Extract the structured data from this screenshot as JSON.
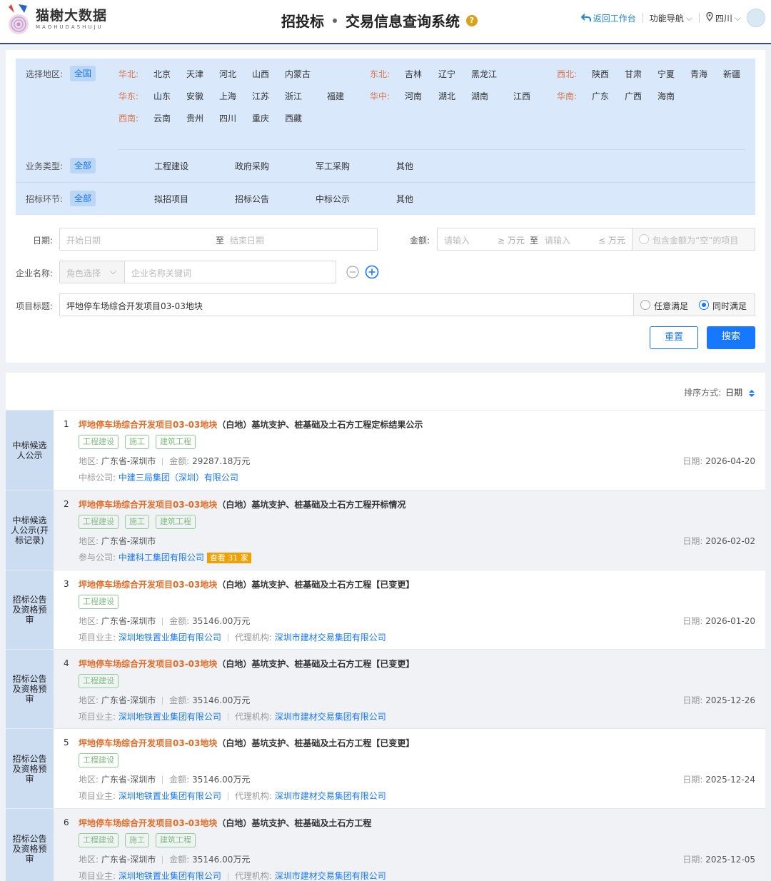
{
  "header": {
    "logo_cn": "猫榭大数据",
    "logo_en": "MAOHUDASHUJU",
    "title_a": "招投标",
    "title_b": "交易信息查询系统",
    "help": "?",
    "back": "返回工作台",
    "nav": "功能导航",
    "location": "四川"
  },
  "filters": {
    "region_label": "选择地区:",
    "region_all": "全国",
    "regions": {
      "huabei": {
        "name": "华北:",
        "items": [
          "北京",
          "天津",
          "河北",
          "山西",
          "内蒙古"
        ]
      },
      "dongbei": {
        "name": "东北:",
        "items": [
          "吉林",
          "辽宁",
          "黑龙江"
        ]
      },
      "xibei": {
        "name": "西北:",
        "items": [
          "陕西",
          "甘肃",
          "宁夏",
          "青海",
          "新疆"
        ]
      },
      "huadong": {
        "name": "华东:",
        "items": [
          "山东",
          "安徽",
          "上海",
          "江苏",
          "浙江",
          "福建"
        ]
      },
      "huazhong": {
        "name": "华中:",
        "items": [
          "河南",
          "湖北",
          "湖南",
          "江西"
        ]
      },
      "huanan": {
        "name": "华南:",
        "items": [
          "广东",
          "广西",
          "海南"
        ]
      },
      "xinan": {
        "name": "西南:",
        "items": [
          "云南",
          "贵州",
          "四川",
          "重庆",
          "西藏"
        ]
      }
    },
    "biz_label": "业务类型:",
    "biz_all": "全部",
    "biz_items": [
      "工程建设",
      "政府采购",
      "军工采购",
      "其他"
    ],
    "stage_label": "招标环节:",
    "stage_all": "全部",
    "stage_items": [
      "拟招项目",
      "招标公告",
      "中标公示",
      "其他"
    ],
    "date_label": "日期:",
    "date_start_ph": "开始日期",
    "date_to": "至",
    "date_end_ph": "结束日期",
    "amount_label": "金额:",
    "amount_min_ph": "请输入",
    "amount_min_unit": "≥ 万元",
    "amount_to": "至",
    "amount_max_ph": "请输入",
    "amount_max_unit": "≤ 万元",
    "amount_empty": "包含金额为“空”的项目",
    "company_label": "企业名称:",
    "role_ph": "角色选择",
    "company_ph": "企业名称关键词",
    "title_label": "项目标题:",
    "title_value": "坪地停车场综合开发项目03-03地块",
    "match_any": "任意满足",
    "match_all": "同时满足",
    "reset": "重置",
    "search": "搜索"
  },
  "results": {
    "sort_label": "排序方式:",
    "sort_value": "日期",
    "items": [
      {
        "num": "1",
        "stage": "中标候选人公示",
        "hl": "坪地停车场综合开发项目03-03地块",
        "rest": "（白地）基坑支护、桩基础及土石方工程定标结果公示",
        "tags": [
          "工程建设",
          "施工",
          "建筑工程"
        ],
        "region_label": "地区:",
        "region": "广东省-深圳市",
        "amount_label": "金额:",
        "amount": "29287.18万元",
        "date_label": "日期:",
        "date": "2026-04-20",
        "c1_label": "中标公司:",
        "c1": "中建三局集团（深圳）有限公司"
      },
      {
        "num": "2",
        "stage": "中标候选人公示(开标记录)",
        "hl": "坪地停车场综合开发项目03-03地块",
        "rest": "（白地）基坑支护、桩基础及土石方工程开标情况",
        "tags": [
          "工程建设",
          "施工",
          "建筑工程"
        ],
        "region_label": "地区:",
        "region": "广东省-深圳市",
        "date_label": "日期:",
        "date": "2026-02-02",
        "c1_label": "参与公司:",
        "c1": "中建科工集团有限公司",
        "count": "查看 31 家"
      },
      {
        "num": "3",
        "stage": "招标公告及资格预审",
        "hl": "坪地停车场综合开发项目03-03地块",
        "rest": "（白地）基坑支护、桩基础及土石方工程【已变更】",
        "tags": [
          "工程建设"
        ],
        "region_label": "地区:",
        "region": "广东省-深圳市",
        "amount_label": "金额:",
        "amount": "35146.00万元",
        "date_label": "日期:",
        "date": "2026-01-20",
        "c1_label": "项目业主:",
        "c1": "深圳地铁置业集团有限公司",
        "c2_label": "代理机构:",
        "c2": "深圳市建材交易集团有限公司"
      },
      {
        "num": "4",
        "stage": "招标公告及资格预审",
        "hl": "坪地停车场综合开发项目03-03地块",
        "rest": "（白地）基坑支护、桩基础及土石方工程【已变更】",
        "tags": [
          "工程建设"
        ],
        "region_label": "地区:",
        "region": "广东省-深圳市",
        "amount_label": "金额:",
        "amount": "35146.00万元",
        "date_label": "日期:",
        "date": "2025-12-26",
        "c1_label": "项目业主:",
        "c1": "深圳地铁置业集团有限公司",
        "c2_label": "代理机构:",
        "c2": "深圳市建材交易集团有限公司"
      },
      {
        "num": "5",
        "stage": "招标公告及资格预审",
        "hl": "坪地停车场综合开发项目03-03地块",
        "rest": "（白地）基坑支护、桩基础及土石方工程【已变更】",
        "tags": [
          "工程建设"
        ],
        "region_label": "地区:",
        "region": "广东省-深圳市",
        "amount_label": "金额:",
        "amount": "35146.00万元",
        "date_label": "日期:",
        "date": "2025-12-24",
        "c1_label": "项目业主:",
        "c1": "深圳地铁置业集团有限公司",
        "c2_label": "代理机构:",
        "c2": "深圳市建材交易集团有限公司"
      },
      {
        "num": "6",
        "stage": "招标公告及资格预审",
        "hl": "坪地停车场综合开发项目03-03地块",
        "rest": "（白地）基坑支护、桩基础及土石方工程",
        "tags": [
          "工程建设",
          "施工",
          "建筑工程"
        ],
        "region_label": "地区:",
        "region": "广东省-深圳市",
        "amount_label": "金额:",
        "amount": "35146.00万元",
        "date_label": "日期:",
        "date": "2025-12-05",
        "c1_label": "项目业主:",
        "c1": "深圳地铁置业集团有限公司",
        "c2_label": "代理机构:",
        "c2": "深圳市建材交易集团有限公司"
      }
    ]
  }
}
